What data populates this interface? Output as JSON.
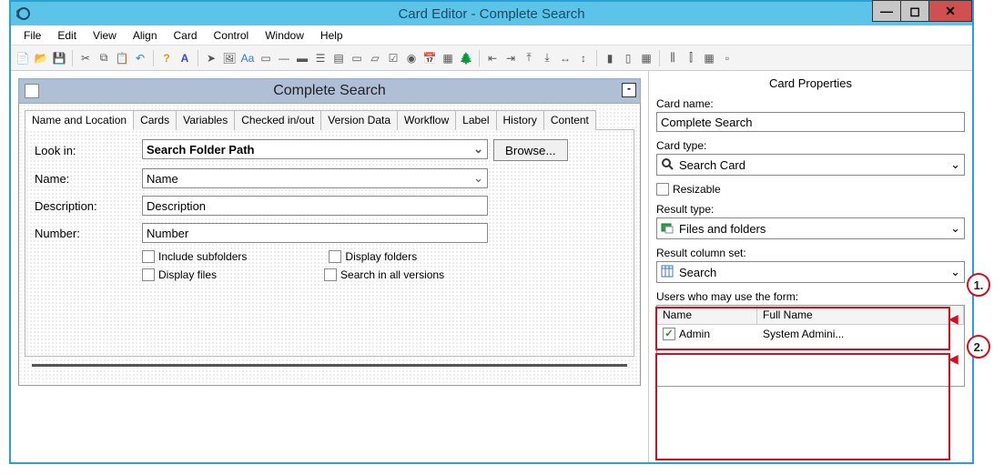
{
  "window": {
    "title": "Card Editor - Complete Search"
  },
  "menu": [
    "File",
    "Edit",
    "View",
    "Align",
    "Card",
    "Control",
    "Window",
    "Help"
  ],
  "card": {
    "title": "Complete Search",
    "minimize": "-",
    "tabs": [
      "Name and Location",
      "Cards",
      "Variables",
      "Checked in/out",
      "Version Data",
      "Workflow",
      "Label",
      "History",
      "Content"
    ],
    "labels": {
      "look_in": "Look in:",
      "name": "Name:",
      "description": "Description:",
      "number": "Number:"
    },
    "fields": {
      "look_in": "Search Folder Path",
      "name": "Name",
      "description": "Description",
      "number": "Number",
      "browse": "Browse..."
    },
    "checks": {
      "include_subfolders": "Include subfolders",
      "display_folders": "Display folders",
      "display_files": "Display files",
      "search_all_versions": "Search in all versions"
    }
  },
  "props": {
    "title": "Card Properties",
    "card_name_lbl": "Card name:",
    "card_name": "Complete Search",
    "card_type_lbl": "Card type:",
    "card_type": "Search Card",
    "resizable": "Resizable",
    "result_type_lbl": "Result type:",
    "result_type": "Files and folders",
    "result_colset_lbl": "Result column set:",
    "result_colset": "Search",
    "users_lbl": "Users who may use the form:",
    "user_table": {
      "headers": {
        "name": "Name",
        "full": "Full Name"
      },
      "rows": [
        {
          "checked": true,
          "name": "Admin",
          "full": "System Admini..."
        }
      ]
    }
  },
  "callouts": {
    "c1": "1.",
    "c2": "2."
  }
}
